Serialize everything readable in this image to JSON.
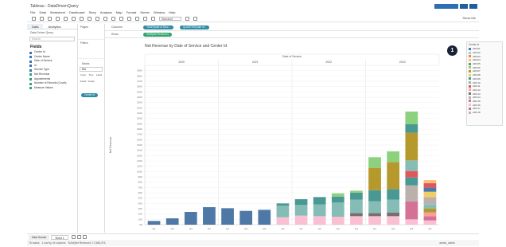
{
  "window": {
    "title": "Tableau - DataDrivenQuery"
  },
  "menu": [
    "File",
    "Data",
    "Worksheet",
    "Dashboard",
    "Story",
    "Analysis",
    "Map",
    "Format",
    "Server",
    "Window",
    "Help"
  ],
  "toolbar": {
    "select_value": "Standard",
    "show_me": "Show Me",
    "user": "Admin"
  },
  "left_panel": {
    "tabs": [
      "Data",
      "Analytics"
    ],
    "datasource": "Data Driven Query",
    "search_placeholder": "Search",
    "fields_header": "Fields",
    "fields": [
      {
        "label": "Center Id",
        "kind": "dim"
      },
      {
        "label": "Center Name",
        "kind": "dim"
      },
      {
        "label": "Date of Service",
        "kind": "dim"
      },
      {
        "label": "Id",
        "kind": "dim"
      },
      {
        "label": "Service Type",
        "kind": "dim"
      },
      {
        "label": "Net Revenue",
        "kind": "mea"
      },
      {
        "label": "Appointments",
        "kind": "mea"
      },
      {
        "label": "Number of Records (Count)",
        "kind": "mea"
      },
      {
        "label": "Measure Values",
        "kind": "mea"
      }
    ]
  },
  "cards": {
    "pages": "Pages",
    "filters": "Filters",
    "marks": "Marks",
    "mark_type": "Bar",
    "mark_buttons": [
      "Color",
      "Size",
      "Label",
      "Detail",
      "Tooltip"
    ],
    "mark_pill": "Center Id"
  },
  "shelves": {
    "columns_label": "Columns",
    "columns_pills": [
      "YEAR(Date of Serv...",
      "QUARTER(Date of..."
    ],
    "rows_label": "Rows",
    "rows_pills": [
      "SUM(Net Revenue)"
    ]
  },
  "legend": {
    "title": "Center Id",
    "items": [
      {
        "label": "ADC01",
        "color": "#4e79a7"
      },
      {
        "label": "ADC02",
        "color": "#a0cbe8"
      },
      {
        "label": "ADC03",
        "color": "#f28e2b"
      },
      {
        "label": "ADC04",
        "color": "#ffbe7d"
      },
      {
        "label": "ADC05",
        "color": "#59a14f"
      },
      {
        "label": "ADC06",
        "color": "#8cd17d"
      },
      {
        "label": "ADC07",
        "color": "#b6992d"
      },
      {
        "label": "ADC08",
        "color": "#f1ce63"
      },
      {
        "label": "ADC09",
        "color": "#499894"
      },
      {
        "label": "ADC10",
        "color": "#86bcb6"
      },
      {
        "label": "ADC11",
        "color": "#e15759"
      },
      {
        "label": "ADC12",
        "color": "#ff9d9a"
      },
      {
        "label": "ADC13",
        "color": "#79706e"
      },
      {
        "label": "ADC14",
        "color": "#bab0ac"
      },
      {
        "label": "ADC15",
        "color": "#d37295"
      },
      {
        "label": "ADC16",
        "color": "#fabfd2"
      },
      {
        "label": "ADC17",
        "color": "#b07aa1"
      },
      {
        "label": "ADC18",
        "color": "#d4a6c8"
      }
    ]
  },
  "badge": "1",
  "bottom": {
    "tabs": [
      "Data Source",
      "Sheet 1"
    ],
    "active": 1
  },
  "status": {
    "marks": "76 marks",
    "rows": "1 row by 15 columns",
    "sum": "SUM(Net Revenue): 17,668,376",
    "user": "admin_admin"
  },
  "chart_data": {
    "type": "bar",
    "title": "Net Revenue by Date of Service and Center Id",
    "header_label": "Date of Service",
    "year_headers": [
      "2020",
      "2021",
      "2022",
      "2023"
    ],
    "xlabel": "",
    "ylabel": "Net Revenue",
    "ylim": [
      0,
      300
    ],
    "yticks": [
      0,
      10,
      20,
      30,
      40,
      50,
      60,
      70,
      80,
      90,
      100,
      110,
      120,
      130,
      140,
      150,
      160,
      170,
      180,
      190,
      200,
      210,
      220,
      230,
      240,
      250,
      260,
      270,
      280,
      290
    ],
    "tick_suffix": "K",
    "categories": [
      "Q1",
      "Q2",
      "Q3",
      "Q4",
      "Q1",
      "Q2",
      "Q3",
      "Q4",
      "Q1",
      "Q2",
      "Q3",
      "Q4",
      "Q1",
      "Q2",
      "Q3",
      "Q4"
    ],
    "stacks": [
      [
        {
          "c": "#4e79a7",
          "v": 7
        }
      ],
      [
        {
          "c": "#4e79a7",
          "v": 12
        }
      ],
      [
        {
          "c": "#4e79a7",
          "v": 24
        }
      ],
      [
        {
          "c": "#4e79a7",
          "v": 33
        }
      ],
      [
        {
          "c": "#4e79a7",
          "v": 31
        }
      ],
      [
        {
          "c": "#4e79a7",
          "v": 26
        }
      ],
      [
        {
          "c": "#4e79a7",
          "v": 28
        },
        {
          "c": "#4e79a7",
          "v": 0
        }
      ],
      [
        {
          "c": "#fabfd2",
          "v": 14
        },
        {
          "c": "#86bcb6",
          "v": 22
        },
        {
          "c": "#499894",
          "v": 4
        }
      ],
      [
        {
          "c": "#fabfd2",
          "v": 17
        },
        {
          "c": "#86bcb6",
          "v": 20
        },
        {
          "c": "#499894",
          "v": 11
        }
      ],
      [
        {
          "c": "#fabfd2",
          "v": 16
        },
        {
          "c": "#86bcb6",
          "v": 22
        },
        {
          "c": "#499894",
          "v": 14
        }
      ],
      [
        {
          "c": "#fabfd2",
          "v": 15
        },
        {
          "c": "#86bcb6",
          "v": 27
        },
        {
          "c": "#499894",
          "v": 11
        },
        {
          "c": "#8cd17d",
          "v": 6
        }
      ],
      [
        {
          "c": "#fabfd2",
          "v": 16
        },
        {
          "c": "#79706e",
          "v": 6
        },
        {
          "c": "#86bcb6",
          "v": 25
        },
        {
          "c": "#499894",
          "v": 13
        },
        {
          "c": "#8cd17d",
          "v": 4
        }
      ],
      [
        {
          "c": "#fabfd2",
          "v": 16
        },
        {
          "c": "#79706e",
          "v": 6
        },
        {
          "c": "#86bcb6",
          "v": 22
        },
        {
          "c": "#499894",
          "v": 21
        },
        {
          "c": "#b6992d",
          "v": 42
        },
        {
          "c": "#8cd17d",
          "v": 20
        }
      ],
      [
        {
          "c": "#fabfd2",
          "v": 16
        },
        {
          "c": "#79706e",
          "v": 7
        },
        {
          "c": "#86bcb6",
          "v": 24
        },
        {
          "c": "#499894",
          "v": 20
        },
        {
          "c": "#b6992d",
          "v": 51
        },
        {
          "c": "#8cd17d",
          "v": 20
        }
      ],
      [
        {
          "c": "#fabfd2",
          "v": 10
        },
        {
          "c": "#d37295",
          "v": 34
        },
        {
          "c": "#bab0ac",
          "v": 30
        },
        {
          "c": "#499894",
          "v": 15
        },
        {
          "c": "#e15759",
          "v": 12
        },
        {
          "c": "#86bcb6",
          "v": 20
        },
        {
          "c": "#b6992d",
          "v": 52
        },
        {
          "c": "#499894",
          "v": 16
        },
        {
          "c": "#8cd17d",
          "v": 24
        }
      ],
      [
        {
          "c": "#fabfd2",
          "v": 8
        },
        {
          "c": "#d37295",
          "v": 8
        },
        {
          "c": "#ff9d9a",
          "v": 7
        },
        {
          "c": "#b6992d",
          "v": 7
        },
        {
          "c": "#86bcb6",
          "v": 8
        },
        {
          "c": "#bab0ac",
          "v": 14
        },
        {
          "c": "#f1ce63",
          "v": 10
        },
        {
          "c": "#4e79a7",
          "v": 8
        },
        {
          "c": "#e15759",
          "v": 8
        },
        {
          "c": "#ffbe7d",
          "v": 6
        }
      ]
    ]
  }
}
